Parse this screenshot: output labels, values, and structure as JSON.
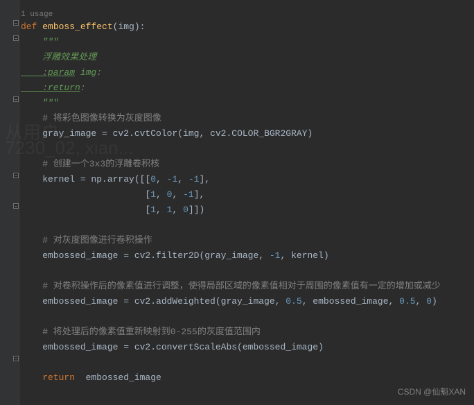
{
  "usage": "1 usage",
  "line1_def": "def ",
  "line1_fn": "emboss_effect",
  "line1_paren": "(img):",
  "doc_open": "    \"\"\"",
  "doc_desc": "    浮雕效果处理",
  "doc_param_tag": "    :param",
  "doc_param_rest": " img:",
  "doc_return_tag": "    :return",
  "doc_return_rest": ":",
  "doc_close": "    \"\"\"",
  "cmt1": "    # 将彩色图像转换为灰度图像",
  "l_gray_a": "    gray_image = cv2.cvtColor(img",
  "l_gray_b": ", ",
  "l_gray_c": "cv2.COLOR_BGR2GRAY)",
  "cmt2": "    # 创建一个3x3的浮雕卷积核",
  "l_kern_a": "    kernel = np.array([[",
  "n0": "0",
  "nm1": "-1",
  "n1": "1",
  "n05": "0.5",
  "sep": ", ",
  "l_kern_end1": "],",
  "l_kern_pad": "                       [",
  "l_kern_end3": "]])",
  "cmt3": "    # 对灰度图像进行卷积操作",
  "l_emb1_a": "    embossed_image = cv2.filter2D(gray_image",
  "l_emb1_b": "kernel)",
  "cmt4": "    # 对卷积操作后的像素值进行调整，使得局部区域的像素值相对于周围的像素值有一定的增加或减少",
  "l_emb2_a": "    embossed_image = cv2.addWeighted(gray_image",
  "l_emb2_b": "embossed_image",
  "rparen": ")",
  "cmt5": "    # 将处理后的像素值重新映射到0-255的灰度值范围内",
  "l_emb3": "    embossed_image = cv2.convertScaleAbs(embossed_image)",
  "ret_kw": "    return",
  "ret_val": "  embossed_image",
  "watermark": "CSDN @仙魁XAN",
  "bgwm": " 从用户\n 7230_02, xian..."
}
